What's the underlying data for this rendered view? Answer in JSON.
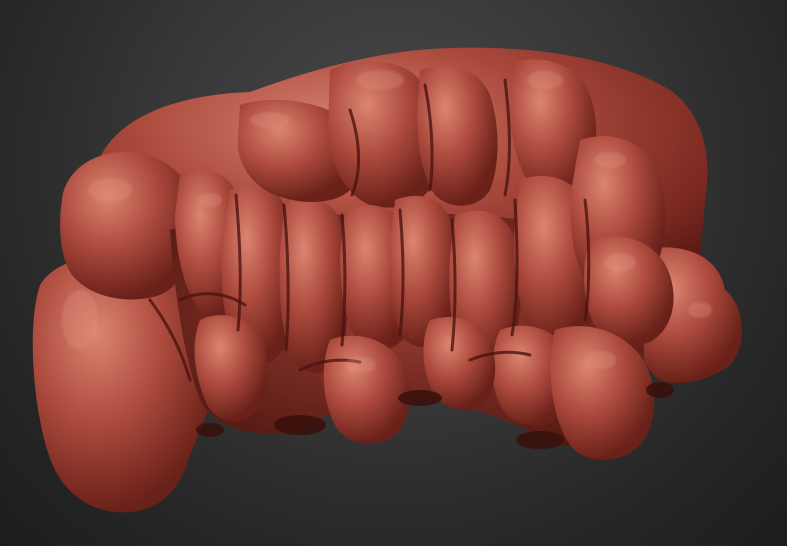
{
  "scene": {
    "subject": "clay-sculpt-mesh",
    "colors": {
      "background_center": "#4a4a4a",
      "background_edge": "#1d1d1d",
      "clay_base": "#a8483c",
      "clay_light": "#d67a68",
      "clay_shadow": "#5e1d16"
    }
  }
}
